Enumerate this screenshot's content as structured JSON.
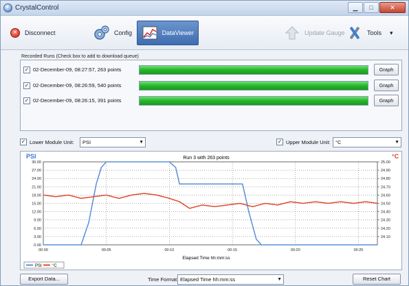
{
  "window": {
    "title": "CrystalControl"
  },
  "toolbar": {
    "disconnect": "Disconnect",
    "config": "Config",
    "dataviewer": "DataViewer",
    "update_gauge": "Update Gauge",
    "tools": "Tools"
  },
  "runs": {
    "label": "Recorded Runs (Check box to add to download queue)",
    "items": [
      {
        "label": "02-December-09, 08:27:57, 263 points",
        "checked": true,
        "progress": 1.0,
        "button": "Graph"
      },
      {
        "label": "02-December-09, 08:26:59, 540 points",
        "checked": true,
        "progress": 1.0,
        "button": "Graph"
      },
      {
        "label": "02-December-09, 08:26:15, 391 points",
        "checked": true,
        "progress": 1.0,
        "button": "Graph"
      }
    ]
  },
  "modules": {
    "lower_label": "Lower Module Unit:",
    "lower_value": "PSI",
    "upper_label": "Upper Module Unit:",
    "upper_value": "°C"
  },
  "chart_data": {
    "type": "line",
    "title": "Run 3 with 263 points",
    "xlabel": "Elapsed Time hh:mm:ss",
    "y_left_label": "PSI",
    "y_right_label": "°C",
    "x_ticks": [
      "00:00",
      "00:05",
      "00:10",
      "00:15",
      "00:20",
      "00:25"
    ],
    "x_range": [
      0,
      26.5
    ],
    "y_left_ticks": [
      "0.00",
      "3.00",
      "6.00",
      "9.00",
      "12.00",
      "15.00",
      "18.00",
      "21.00",
      "24.00",
      "27.00",
      "30.00"
    ],
    "y_left_range": [
      0,
      30
    ],
    "y_right_ticks": [
      "24.10",
      "24.20",
      "24.30",
      "24.40",
      "24.50",
      "24.60",
      "24.70",
      "24.80",
      "24.90",
      "25.00"
    ],
    "y_right_range": [
      24.0,
      25.0
    ],
    "grid": true,
    "legend_position": "bottom-left",
    "series": [
      {
        "name": "PSI",
        "axis": "left",
        "color": "#5a8fd6",
        "points": [
          [
            0,
            0
          ],
          [
            3.0,
            0
          ],
          [
            3.6,
            8
          ],
          [
            4.2,
            22
          ],
          [
            4.6,
            28
          ],
          [
            5.0,
            30
          ],
          [
            10.0,
            30
          ],
          [
            10.5,
            28
          ],
          [
            10.8,
            22
          ],
          [
            15.8,
            22
          ],
          [
            16.3,
            12
          ],
          [
            16.9,
            2
          ],
          [
            17.3,
            0
          ],
          [
            26.5,
            0
          ]
        ]
      },
      {
        "name": "°C",
        "axis": "right",
        "color": "#e04a2a",
        "points": [
          [
            0,
            24.6
          ],
          [
            1,
            24.58
          ],
          [
            2,
            24.6
          ],
          [
            3,
            24.56
          ],
          [
            4,
            24.58
          ],
          [
            5,
            24.6
          ],
          [
            6,
            24.56
          ],
          [
            7,
            24.6
          ],
          [
            8,
            24.62
          ],
          [
            9,
            24.6
          ],
          [
            10,
            24.56
          ],
          [
            10.8,
            24.52
          ],
          [
            11.6,
            24.44
          ],
          [
            12.6,
            24.48
          ],
          [
            13.6,
            24.46
          ],
          [
            14.6,
            24.48
          ],
          [
            15.6,
            24.5
          ],
          [
            16.6,
            24.46
          ],
          [
            17.6,
            24.5
          ],
          [
            18.6,
            24.48
          ],
          [
            19.6,
            24.52
          ],
          [
            20.6,
            24.5
          ],
          [
            21.6,
            24.52
          ],
          [
            22.6,
            24.5
          ],
          [
            23.6,
            24.52
          ],
          [
            24.6,
            24.5
          ],
          [
            25.6,
            24.52
          ],
          [
            26.5,
            24.5
          ]
        ]
      }
    ]
  },
  "bottom": {
    "export": "Export Data...",
    "time_format_label": "Time Format:",
    "time_format_value": "Elapsed Time hh:mm:ss",
    "reset": "Reset Chart"
  }
}
